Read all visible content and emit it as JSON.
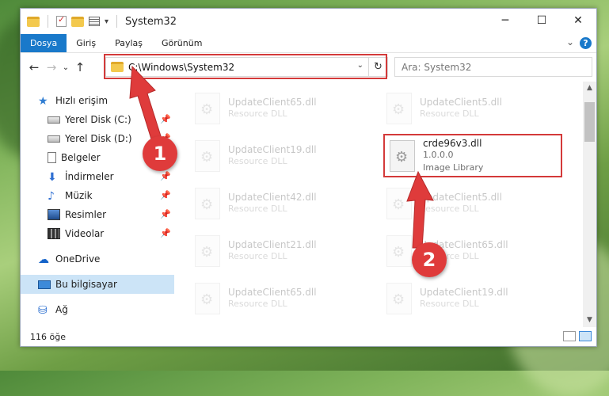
{
  "window": {
    "title": "System32",
    "controls": {
      "minimize": "─",
      "maximize": "☐",
      "close": "✕"
    }
  },
  "ribbon": {
    "tabs": [
      "Dosya",
      "Giriş",
      "Paylaş",
      "Görünüm"
    ],
    "help": "?",
    "collapse": "⌄"
  },
  "navigation": {
    "back": "←",
    "forward": "→",
    "recent": "⌄",
    "up": "↑"
  },
  "address": {
    "path": "C:\\Windows\\System32",
    "dropdown": "⌄",
    "refresh": "↻"
  },
  "search": {
    "placeholder": "Ara: System32"
  },
  "sidebar": {
    "items": [
      {
        "label": "Hızlı erişim",
        "icon": "star-icon"
      },
      {
        "label": "Yerel Disk (C:)",
        "icon": "drive-icon",
        "pinned": true
      },
      {
        "label": "Yerel Disk (D:)",
        "icon": "drive-icon",
        "pinned": true
      },
      {
        "label": "Belgeler",
        "icon": "documents-icon",
        "pinned": true
      },
      {
        "label": "İndirmeler",
        "icon": "download-icon",
        "pinned": true
      },
      {
        "label": "Müzik",
        "icon": "music-icon",
        "pinned": true
      },
      {
        "label": "Resimler",
        "icon": "pictures-icon",
        "pinned": true
      },
      {
        "label": "Videolar",
        "icon": "videos-icon",
        "pinned": true
      },
      {
        "label": "OneDrive",
        "icon": "cloud-icon"
      },
      {
        "label": "Bu bilgisayar",
        "icon": "computer-icon",
        "selected": true
      },
      {
        "label": "Ağ",
        "icon": "network-icon"
      }
    ]
  },
  "files": {
    "left": [
      {
        "name": "UpdateClient65.dll",
        "type": "Resource DLL"
      },
      {
        "name": "UpdateClient19.dll",
        "type": "Resource DLL"
      },
      {
        "name": "UpdateClient42.dll",
        "type": "Resource DLL"
      },
      {
        "name": "UpdateClient21.dll",
        "type": "Resource DLL"
      },
      {
        "name": "UpdateClient65.dll",
        "type": "Resource DLL"
      }
    ],
    "right": [
      {
        "name": "UpdateClient5.dll",
        "type": "Resource DLL"
      },
      {
        "name": "crde96v3.dll",
        "version": "1.0.0.0",
        "type": "Image Library"
      },
      {
        "name": "UpdateClient5.dll",
        "type": "Resource DLL"
      },
      {
        "name": "UpdateClient65.dll",
        "type": "Resource DLL"
      },
      {
        "name": "UpdateClient19.dll",
        "type": "Resource DLL"
      }
    ]
  },
  "status": {
    "count": "116 öğe"
  },
  "annotations": {
    "step1": "1",
    "step2": "2",
    "color": "#df3b3b"
  }
}
